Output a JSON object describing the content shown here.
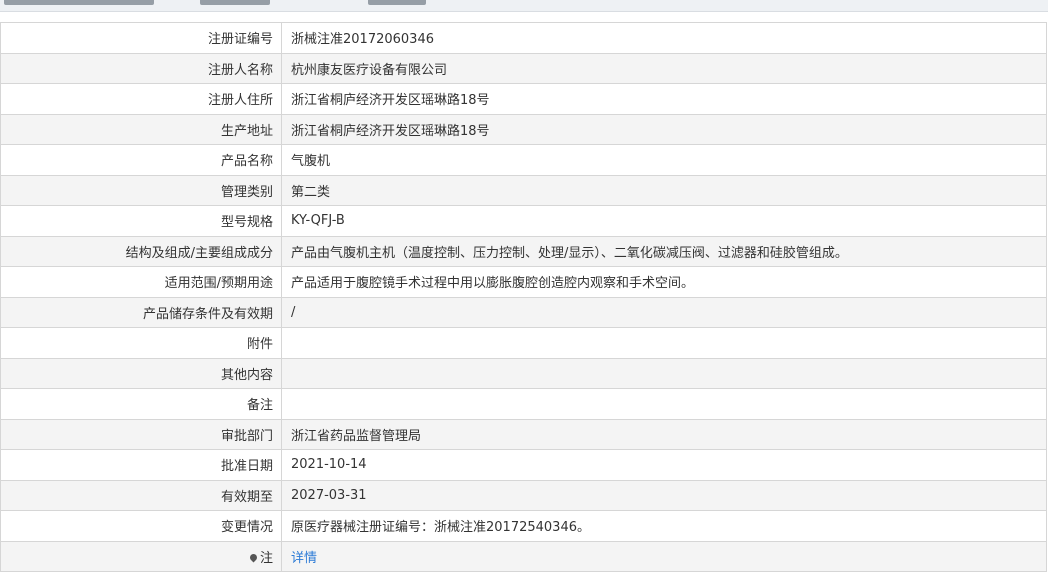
{
  "rows": [
    {
      "label": "注册证编号",
      "value": "浙械注准20172060346"
    },
    {
      "label": "注册人名称",
      "value": "杭州康友医疗设备有限公司"
    },
    {
      "label": "注册人住所",
      "value": "浙江省桐庐经济开发区瑶琳路18号"
    },
    {
      "label": "生产地址",
      "value": "浙江省桐庐经济开发区瑶琳路18号"
    },
    {
      "label": "产品名称",
      "value": "气腹机"
    },
    {
      "label": "管理类别",
      "value": "第二类"
    },
    {
      "label": "型号规格",
      "value": "KY-QFJ-B"
    },
    {
      "label": "结构及组成/主要组成成分",
      "value": "产品由气腹机主机（温度控制、压力控制、处理/显示）、二氧化碳减压阀、过滤器和硅胶管组成。"
    },
    {
      "label": "适用范围/预期用途",
      "value": "产品适用于腹腔镜手术过程中用以膨胀腹腔创造腔内观察和手术空间。"
    },
    {
      "label": "产品储存条件及有效期",
      "value": "/"
    },
    {
      "label": "附件",
      "value": ""
    },
    {
      "label": "其他内容",
      "value": ""
    },
    {
      "label": "备注",
      "value": ""
    },
    {
      "label": "审批部门",
      "value": "浙江省药品监督管理局"
    },
    {
      "label": "批准日期",
      "value": "2021-10-14"
    },
    {
      "label": "有效期至",
      "value": "2027-03-31"
    },
    {
      "label": "变更情况",
      "value": "原医疗器械注册证编号：浙械注准20172540346。"
    }
  ],
  "note": {
    "label": "注",
    "link": "详情",
    "icon": "pin-icon"
  },
  "colors": {
    "border": "#d6d6d6",
    "stripe": "#f4f4f4",
    "link": "#2c7bd6"
  }
}
